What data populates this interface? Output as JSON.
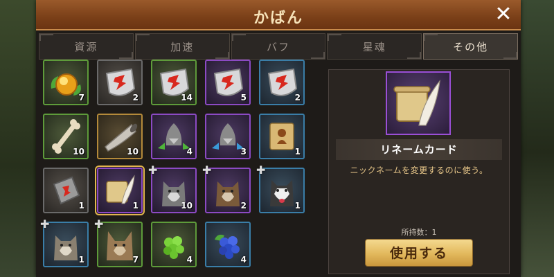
{
  "window": {
    "title": "かばん"
  },
  "tabs": [
    {
      "label": "資源"
    },
    {
      "label": "加速"
    },
    {
      "label": "バフ"
    },
    {
      "label": "星魂"
    },
    {
      "label": "その他"
    }
  ],
  "active_tab": "その他",
  "items": [
    {
      "icon": "golden-orb-icon",
      "rarity": "green",
      "qty": "7"
    },
    {
      "icon": "red-emblem-shield-icon",
      "rarity": "gray",
      "qty": "2"
    },
    {
      "icon": "red-emblem-shield-icon",
      "rarity": "green",
      "qty": "14"
    },
    {
      "icon": "red-emblem-shield-icon",
      "rarity": "purple",
      "qty": "5"
    },
    {
      "icon": "red-emblem-shield-icon",
      "rarity": "blue",
      "qty": "2"
    },
    {
      "icon": "bone-icon",
      "rarity": "green",
      "qty": "10"
    },
    {
      "icon": "horn-icon",
      "rarity": "gold",
      "qty": "10"
    },
    {
      "icon": "wolf-green-arrows-icon",
      "rarity": "purple",
      "qty": "4"
    },
    {
      "icon": "wolf-blue-arrows-icon",
      "rarity": "purple",
      "qty": "3"
    },
    {
      "icon": "monkey-scroll-icon",
      "rarity": "blue",
      "qty": "1"
    },
    {
      "icon": "red-emblem-stone-icon",
      "rarity": "gray",
      "qty": "1"
    },
    {
      "icon": "scroll-quill-icon",
      "rarity": "purple",
      "qty": "1"
    },
    {
      "icon": "gray-wolf-icon",
      "rarity": "purple",
      "qty": "10"
    },
    {
      "icon": "brown-wolf-icon",
      "rarity": "purple",
      "qty": "2"
    },
    {
      "icon": "husky-icon",
      "rarity": "blue",
      "qty": "1"
    },
    {
      "icon": "wolf-pup-icon",
      "rarity": "blue",
      "qty": "1"
    },
    {
      "icon": "jackal-icon",
      "rarity": "green",
      "qty": "7"
    },
    {
      "icon": "green-berry-icon",
      "rarity": "green",
      "qty": "4"
    },
    {
      "icon": "blue-berry-icon",
      "rarity": "blue",
      "qty": "4"
    }
  ],
  "selected": {
    "icon": "scroll-quill-icon",
    "name": "リネームカード",
    "description": "ニックネームを変更するのに使う。",
    "owned": "所持数：1",
    "button_label": "使用する"
  },
  "colors": {
    "accent": "#e2b85c",
    "title_bar": "#7a3f18",
    "desc_text": "#e9c88a"
  }
}
